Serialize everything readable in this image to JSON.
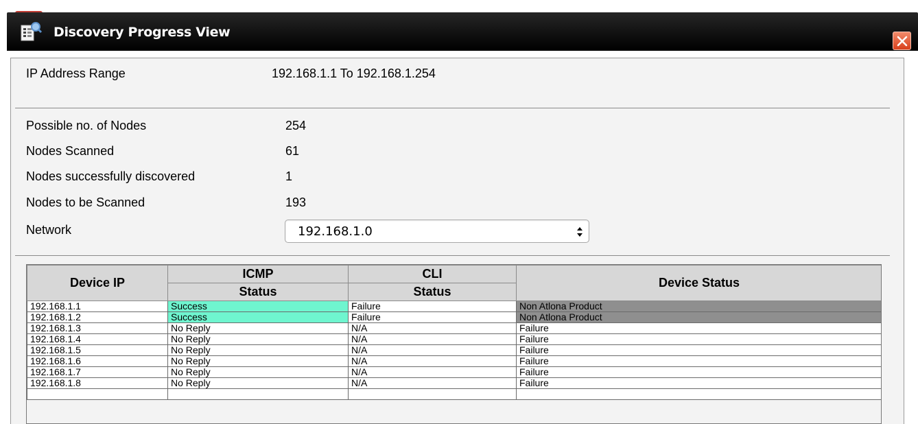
{
  "window": {
    "title": "Discovery Progress View",
    "close_icon": "close-icon"
  },
  "summary": {
    "ip_range_label": "IP Address Range",
    "ip_range_value": "192.168.1.1 To 192.168.1.254",
    "possible_nodes_label": "Possible no. of Nodes",
    "possible_nodes_value": "254",
    "nodes_scanned_label": "Nodes Scanned",
    "nodes_scanned_value": "61",
    "nodes_discovered_label": "Nodes successfully discovered",
    "nodes_discovered_value": "1",
    "nodes_to_scan_label": "Nodes to be Scanned",
    "nodes_to_scan_value": "193",
    "network_label": "Network",
    "network_value": "192.168.1.0"
  },
  "table": {
    "headers": {
      "device_ip": "Device IP",
      "icmp": "ICMP",
      "icmp_status": "Status",
      "cli": "CLI",
      "cli_status": "Status",
      "device_status": "Device Status"
    },
    "rows": [
      {
        "ip": "192.168.1.1",
        "icmp": "Success",
        "cli": "Failure",
        "device": "Non Atlona Product"
      },
      {
        "ip": "192.168.1.2",
        "icmp": "Success",
        "cli": "Failure",
        "device": "Non Atlona Product"
      },
      {
        "ip": "192.168.1.3",
        "icmp": "No Reply",
        "cli": "N/A",
        "device": "Failure"
      },
      {
        "ip": "192.168.1.4",
        "icmp": "No Reply",
        "cli": "N/A",
        "device": "Failure"
      },
      {
        "ip": "192.168.1.5",
        "icmp": "No Reply",
        "cli": "N/A",
        "device": "Failure"
      },
      {
        "ip": "192.168.1.6",
        "icmp": "No Reply",
        "cli": "N/A",
        "device": "Failure"
      },
      {
        "ip": "192.168.1.7",
        "icmp": "No Reply",
        "cli": "N/A",
        "device": "Failure"
      },
      {
        "ip": "192.168.1.8",
        "icmp": "No Reply",
        "cli": "N/A",
        "device": "Failure"
      },
      {
        "ip": "",
        "icmp": "",
        "cli": "",
        "device": ""
      }
    ]
  },
  "colors": {
    "titlebar": "#000000",
    "success": "#6ff5cf",
    "non_atlona": "#8f8f8f",
    "header_bg": "#d7d7d7",
    "close": "#d8401c"
  }
}
